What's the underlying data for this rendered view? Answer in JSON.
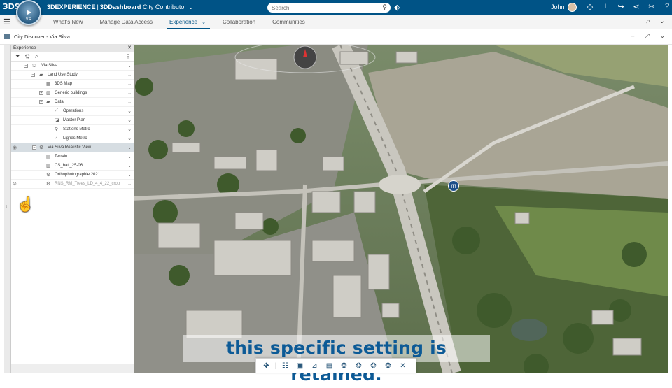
{
  "topbar": {
    "brand": "3DS",
    "compass_version": "V.R",
    "app_name": "3DEXPERIENCE",
    "separator": "|",
    "dashboard": "3DDashboard",
    "role": "City Contributor",
    "role_chevron": "⌄",
    "search_placeholder": "Search",
    "user": "John"
  },
  "tabbar": {
    "tabs": [
      {
        "label": "What's New"
      },
      {
        "label": "Manage Data Access"
      },
      {
        "label": "Experience",
        "active": true
      },
      {
        "label": "Collaboration"
      },
      {
        "label": "Communities"
      }
    ]
  },
  "widget": {
    "title": "City Discover - Via Silva"
  },
  "panel": {
    "header": "Experience",
    "tree": [
      {
        "label": "Via Silva",
        "indent": 0,
        "icon": "city-icon"
      },
      {
        "label": "Land Use Study",
        "indent": 1,
        "icon": "folder-icon"
      },
      {
        "label": "3DS Map",
        "indent": 2,
        "icon": "map-icon"
      },
      {
        "label": "Generic buildings",
        "indent": 2,
        "icon": "building-icon"
      },
      {
        "label": "Data",
        "indent": 2,
        "icon": "folder-icon"
      },
      {
        "label": "Operations",
        "indent": 3,
        "icon": "line-icon"
      },
      {
        "label": "Master Plan",
        "indent": 3,
        "icon": "shape-icon"
      },
      {
        "label": "Stations Metro",
        "indent": 3,
        "icon": "pin-icon"
      },
      {
        "label": "Lignes Metro",
        "indent": 3,
        "icon": "line-icon"
      },
      {
        "label": "Via Silva Realistic View",
        "indent": 0,
        "icon": "gear-icon",
        "highlight": true
      },
      {
        "label": "Terrain",
        "indent": 1,
        "icon": "terrain-icon"
      },
      {
        "label": "CS_bati_25-06",
        "indent": 1,
        "icon": "building-icon"
      },
      {
        "label": "Orthophotographie 2021",
        "indent": 1,
        "icon": "gear-icon"
      },
      {
        "label": "RNS_RM_Trees_LD_4_4_22_crop",
        "indent": 1,
        "icon": "gear-icon",
        "dim": true
      }
    ]
  },
  "viewport": {
    "metro_marker": "m"
  },
  "caption": {
    "text": "this specific setting is retained."
  }
}
